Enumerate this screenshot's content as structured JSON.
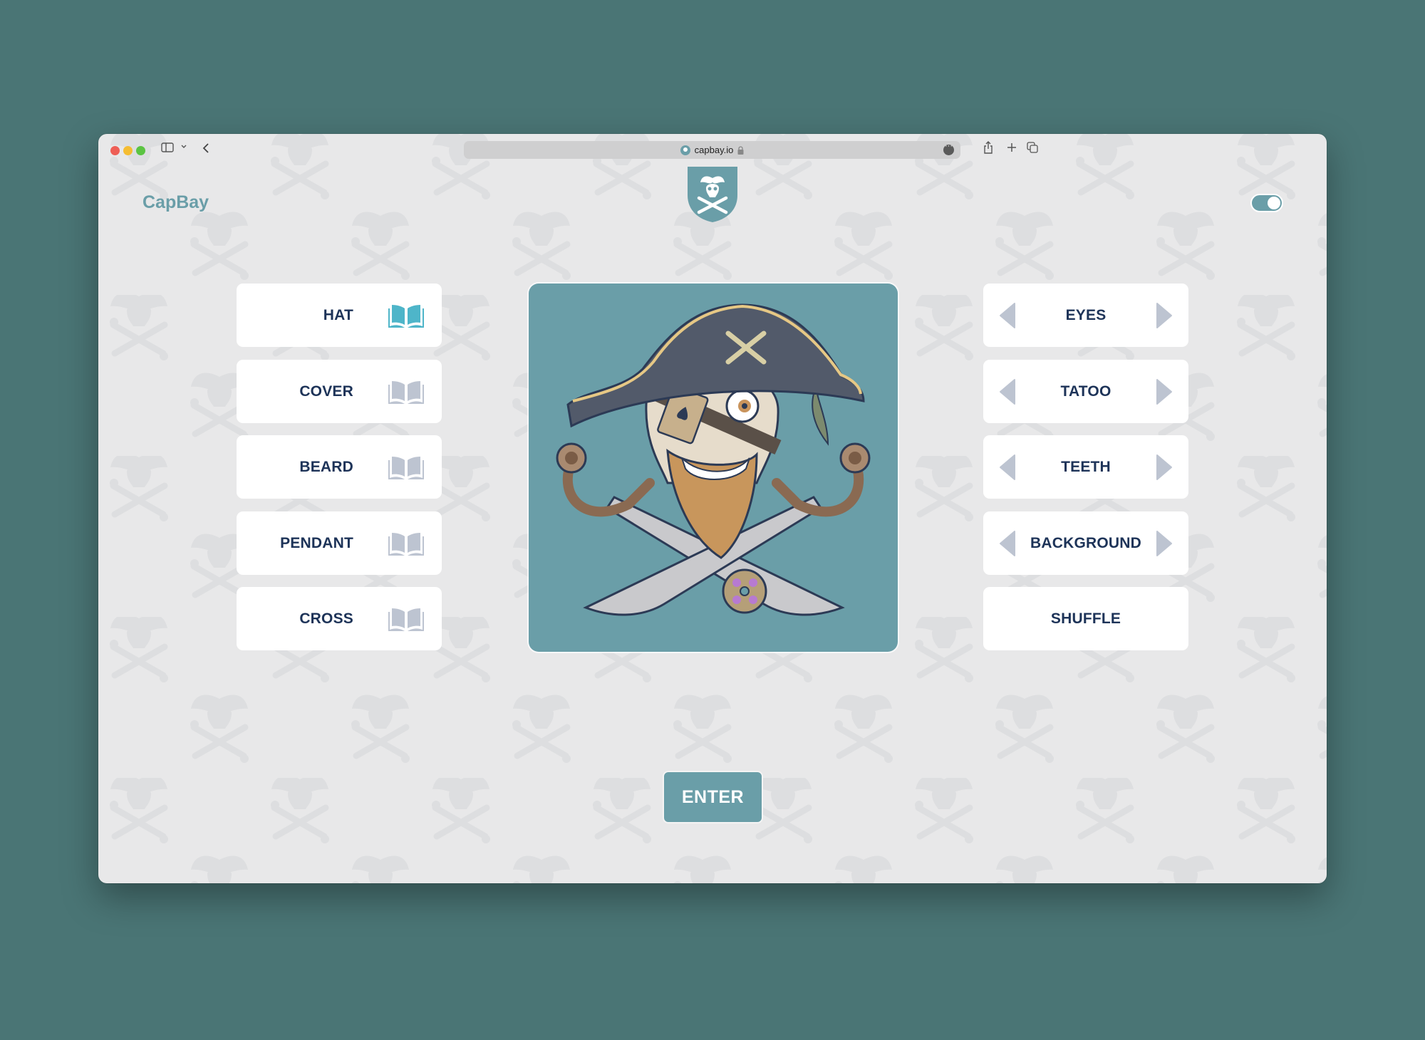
{
  "browser": {
    "url": "capbay.io",
    "secure_lock": true,
    "toolbar_icons": [
      "sidebar-icon",
      "chevron-down-icon",
      "back-icon",
      "share-icon",
      "new-tab-icon",
      "tabs-overview-icon"
    ]
  },
  "header": {
    "brand": "CapBay",
    "logo": "pirate-shield-logo",
    "theme_toggle_on": true
  },
  "left_options": [
    {
      "label": "HAT",
      "icon": "book-icon",
      "active": true
    },
    {
      "label": "COVER",
      "icon": "book-icon",
      "active": false
    },
    {
      "label": "BEARD",
      "icon": "book-icon",
      "active": false
    },
    {
      "label": "PENDANT",
      "icon": "book-icon",
      "active": false
    },
    {
      "label": "CROSS",
      "icon": "book-icon",
      "active": false
    }
  ],
  "right_options": [
    {
      "label": "EYES",
      "has_arrows": true
    },
    {
      "label": "TATOO",
      "has_arrows": true
    },
    {
      "label": "TEETH",
      "has_arrows": true
    },
    {
      "label": "BACKGROUND",
      "has_arrows": true
    },
    {
      "label": "SHUFFLE",
      "has_arrows": false
    }
  ],
  "preview": {
    "description": "Pirate skull avatar with tricorn hat, ace-of-spades eye patch, beard, crossed cutlasses and jeweled pendant"
  },
  "enter_label": "ENTER",
  "colors": {
    "accent": "#6a9ea8",
    "active_icon": "#4eb5c9",
    "inactive_icon": "#bdc4d1",
    "label": "#1d3358",
    "page_bg": "#e8e8e9",
    "desktop_bg": "#4a7575"
  }
}
